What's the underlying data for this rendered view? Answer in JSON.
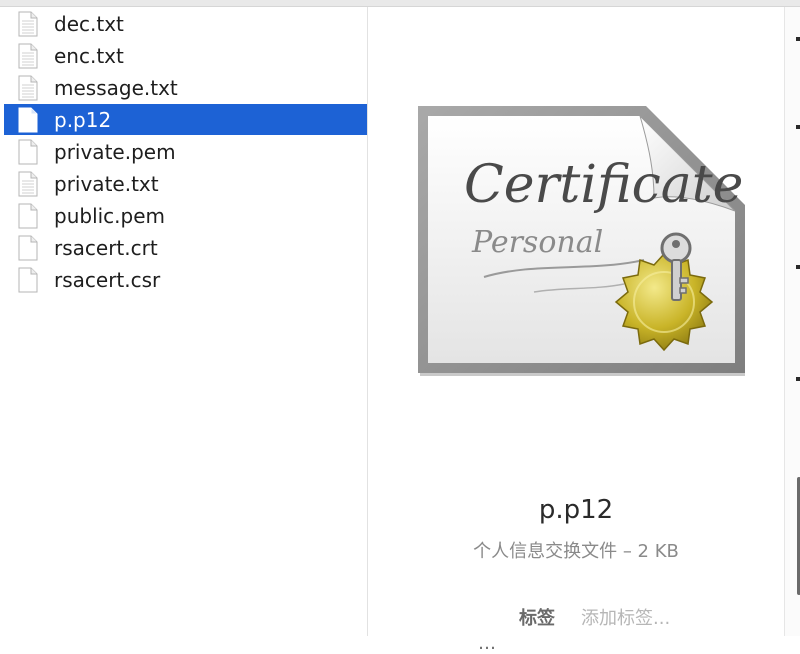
{
  "files": [
    {
      "name": "dec.txt",
      "selected": false
    },
    {
      "name": "enc.txt",
      "selected": false
    },
    {
      "name": "message.txt",
      "selected": false
    },
    {
      "name": "p.p12",
      "selected": true
    },
    {
      "name": "private.pem",
      "selected": false
    },
    {
      "name": "private.txt",
      "selected": false
    },
    {
      "name": "public.pem",
      "selected": false
    },
    {
      "name": "rsacert.crt",
      "selected": false
    },
    {
      "name": "rsacert.csr",
      "selected": false
    }
  ],
  "preview": {
    "title": "p.p12",
    "kind": "个人信息交换文件 – 2 KB",
    "tags_label": "标签",
    "tags_placeholder": "添加标签...",
    "cert_title": "Certificate",
    "cert_subtitle": "Personal",
    "cut_text": "…"
  },
  "colors": {
    "selection": "#1d62d5",
    "seal": "#c9b428"
  }
}
